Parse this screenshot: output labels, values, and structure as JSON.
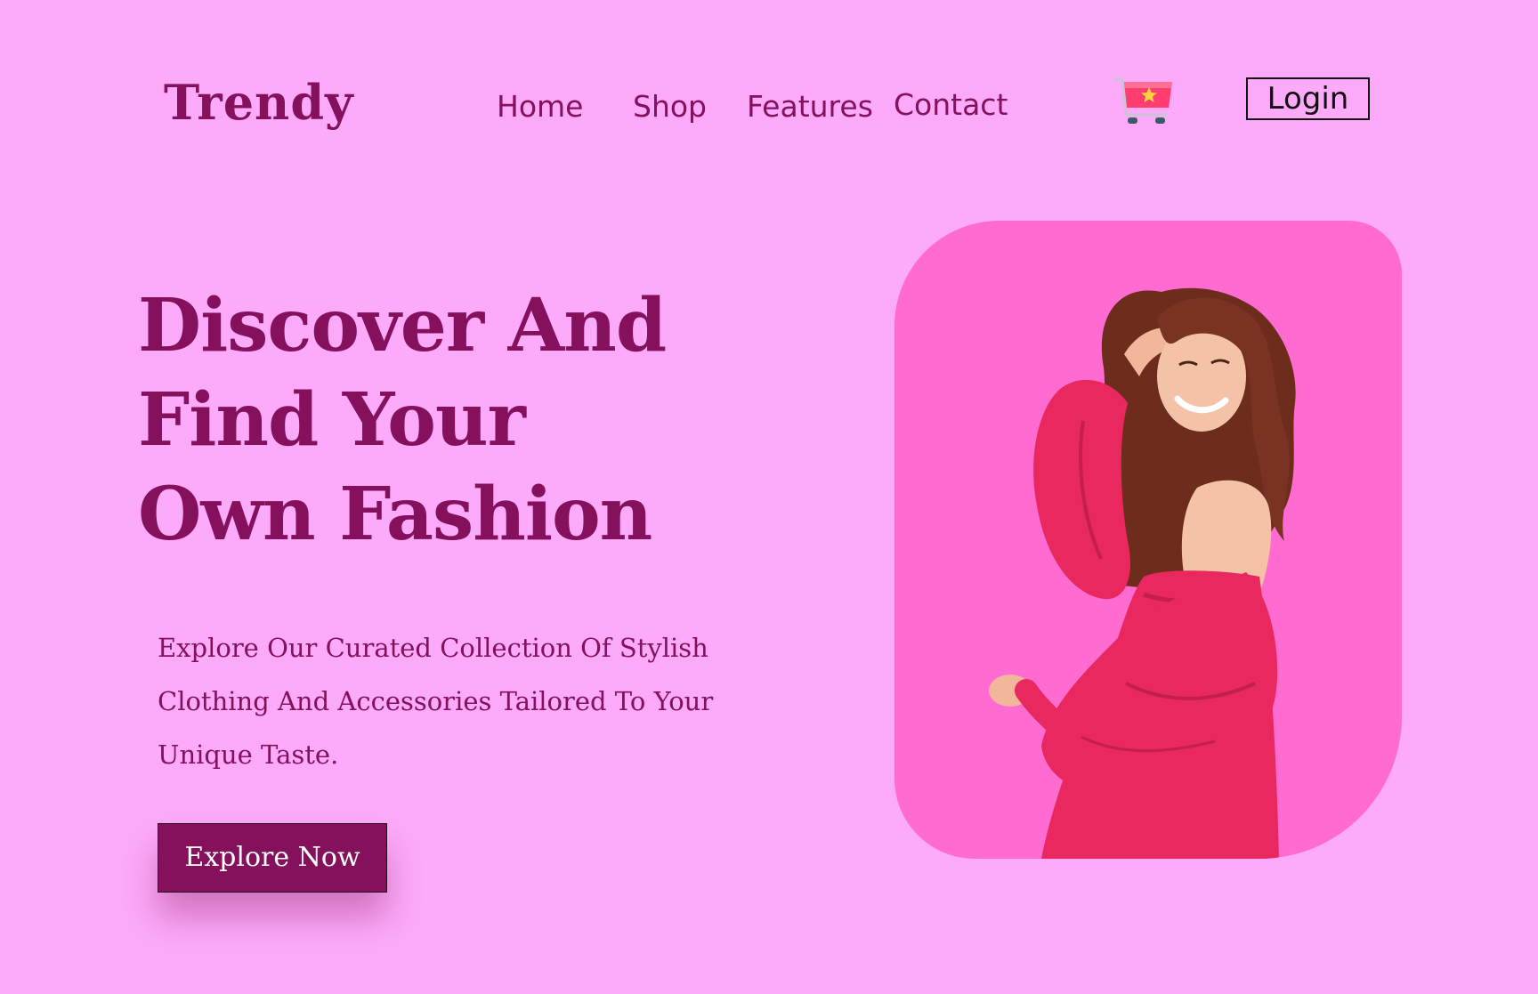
{
  "brand": {
    "logo_text": "Trendy"
  },
  "nav": {
    "items": [
      {
        "label": "Home"
      },
      {
        "label": "Shop"
      },
      {
        "label": "Features"
      },
      {
        "label": "Contact"
      }
    ],
    "cart_icon": "shopping-cart-icon",
    "login_label": "Login"
  },
  "hero": {
    "title_lines": [
      "Discover And",
      "Find Your",
      "Own Fashion"
    ],
    "description": "Explore Our Curated Collection Of Stylish Clothing And Accessories Tailored To Your Unique Taste.",
    "cta_label": "Explore Now",
    "image_alt": "woman-in-pink-dress"
  },
  "colors": {
    "background": "#fdaafa",
    "brand": "#85105c",
    "card": "#ff6bd0",
    "dress": "#e8285f",
    "cart": "#ff3d6e"
  }
}
